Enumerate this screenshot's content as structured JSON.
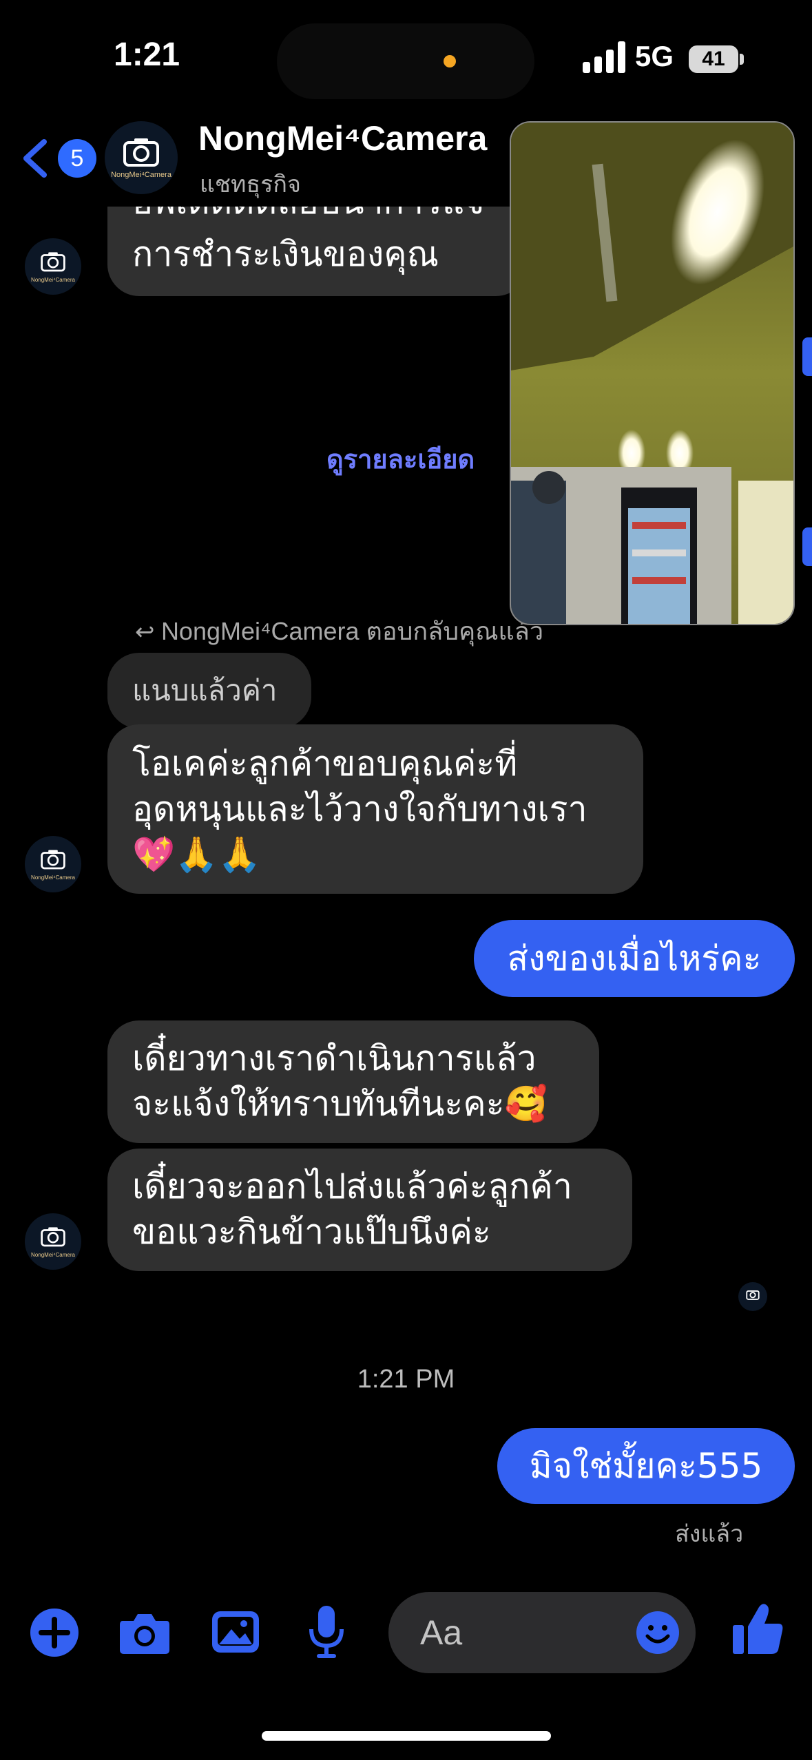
{
  "status": {
    "time": "1:21",
    "network": "5G",
    "battery": "41"
  },
  "header": {
    "back_badge": "5",
    "contact_name": "NongMei⁴Camera",
    "subtitle": "แชทธุรกิจ",
    "avatar_brand": "NongMei⁴Camera"
  },
  "messages": {
    "cut_line": "อัพเดตดตลอบ่นาการแจ",
    "cut_text": "การชำระเงินของคุณ",
    "view_details": "ดูรายละเอียด",
    "reply_note": "NongMei⁴Camera ตอบกลับคุณแล้ว",
    "quoted": "แนบแล้วค่า",
    "thanks_line1": "โอเคค่ะลูกค้าขอบคุณค่ะที่",
    "thanks_line2": "อุดหนุนและไว้วางใจกับทางเรา",
    "thanks_line3": "💖🙏🙏",
    "out_when": "ส่งของเมื่อไหร่คะ",
    "processing_line1": "เดี๋ยวทางเราดำเนินการแล้ว",
    "processing_line2": "จะแจ้งให้ทราบทันทีนะคะ🥰",
    "leaving_line1": "เดี๋ยวจะออกไปส่งแล้วค่ะลูกค้า",
    "leaving_line2": "ขอแวะกินข้าวแป๊บนึงค่ะ",
    "timestamp": "1:21 PM",
    "out_scam": "มิจใช่มั้ยคะ555",
    "sent_status": "ส่งแล้ว"
  },
  "composer": {
    "placeholder": "Aa"
  },
  "colors": {
    "accent": "#3461f2",
    "bubble_in": "#303030",
    "background": "#000000"
  },
  "icons": [
    "back-chevron-icon",
    "camera-icon",
    "plus-icon",
    "photo-icon",
    "mic-icon",
    "emoji-icon",
    "thumbs-up-icon"
  ]
}
